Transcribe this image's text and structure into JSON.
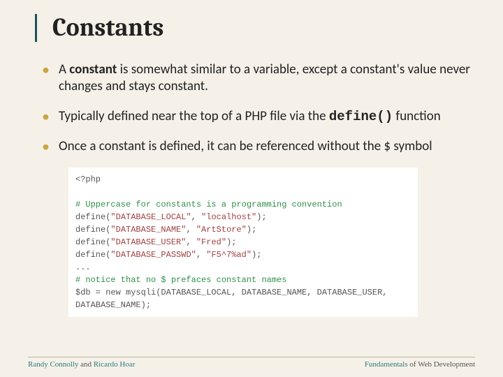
{
  "title": "Constants",
  "bullets": {
    "b1_pre": "A ",
    "b1_bold": "constant",
    "b1_post": " is somewhat similar to a variable, except a constant's value never changes and stays constant.",
    "b2_pre": "Typically defined near the top of a PHP file via the ",
    "b2_code": "define()",
    "b2_post": " function",
    "b3": "Once a constant is defined, it can be referenced without the $ symbol"
  },
  "code": {
    "l1": "<?php",
    "c1": "# Uppercase for constants is a programming convention",
    "d1a": "define(",
    "d1b": "\"DATABASE_LOCAL\"",
    "d1c": ", ",
    "d1d": "\"localhost\"",
    "d1e": ");",
    "d2a": "define(",
    "d2b": "\"DATABASE_NAME\"",
    "d2c": ", ",
    "d2d": "\"ArtStore\"",
    "d2e": ");",
    "d3a": "define(",
    "d3b": "\"DATABASE_USER\"",
    "d3c": ", ",
    "d3d": "\"Fred\"",
    "d3e": ");",
    "d4a": "define(",
    "d4b": "\"DATABASE_PASSWD\"",
    "d4c": ", ",
    "d4d": "\"F5^7%ad\"",
    "d4e": ");",
    "dots": "...",
    "c2": "# notice that no $ prefaces constant names",
    "l9": "$db = new mysqli(DATABASE_LOCAL, DATABASE_NAME, DATABASE_USER,",
    "l10": "DATABASE_NAME);"
  },
  "footer": {
    "left_a": "Randy Connolly",
    "left_mid": " and ",
    "left_b": "Ricardo Hoar",
    "right_a": "Fundamentals",
    "right_b": " of Web Development"
  }
}
